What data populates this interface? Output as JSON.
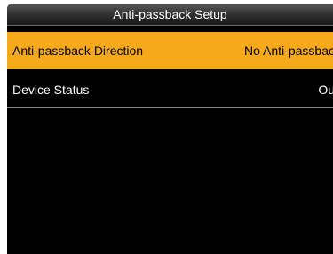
{
  "header": {
    "title": "Anti-passback Setup"
  },
  "menu": {
    "items": [
      {
        "label": "Anti-passback  Direction",
        "value": "No Anti-passbac",
        "selected": true
      },
      {
        "label": "Device Status",
        "value": "Ou",
        "selected": false
      }
    ]
  },
  "colors": {
    "selected_row": "#f6a91a",
    "background": "#000000",
    "titlebar": "#2e2e2e"
  }
}
